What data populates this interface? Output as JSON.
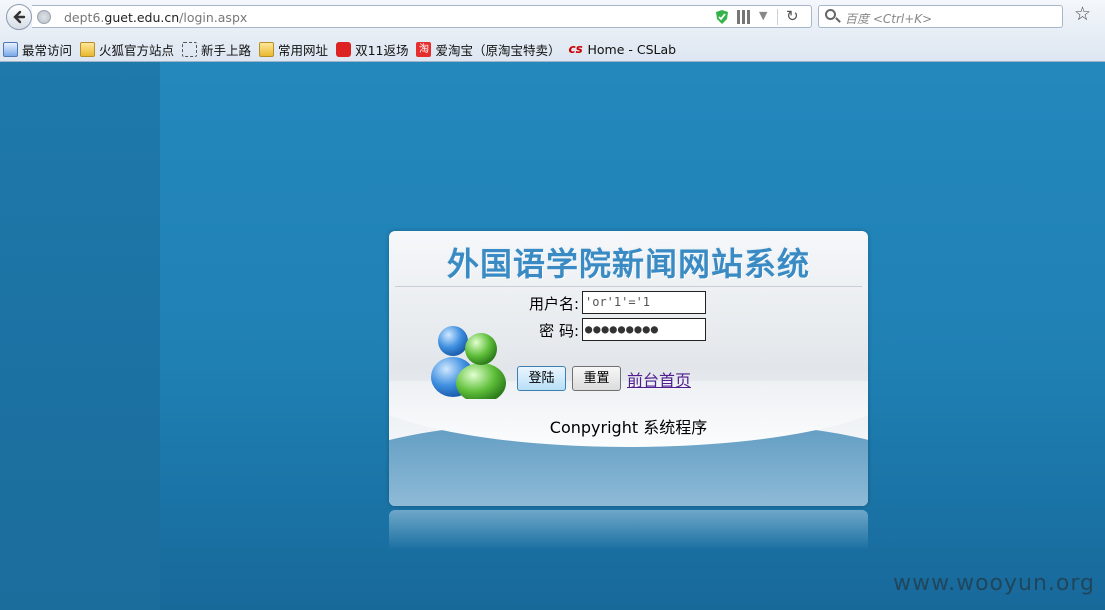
{
  "browser": {
    "url_prefix": "dept6.",
    "url_domain": "guet.edu.cn",
    "url_path": "/login.aspx",
    "search_placeholder": "百度 <Ctrl+K>"
  },
  "bookmarks": [
    {
      "label": "最常访问",
      "icon": "recent-icon"
    },
    {
      "label": "火狐官方站点",
      "icon": "folder-icon"
    },
    {
      "label": "新手上路",
      "icon": "dotted-page-icon"
    },
    {
      "label": "常用网址",
      "icon": "folder-icon"
    },
    {
      "label": "双11返场",
      "icon": "red-bag-icon"
    },
    {
      "label": "爱淘宝（原淘宝特卖）",
      "icon": "taobao-icon",
      "icon_glyph": "淘"
    },
    {
      "label": "Home - CSLab",
      "icon": "cslab-icon",
      "icon_glyph": "cs"
    }
  ],
  "login": {
    "title": "外国语学院新闻网站系统",
    "username_label": "用户名:",
    "password_label": "密 码:",
    "username_value": "'or'1'='1",
    "password_mask": "●●●●●●●●●",
    "login_button": "登陆",
    "reset_button": "重置",
    "front_link": "前台首页",
    "copyright": "Conpyright 系统程序"
  },
  "watermark": "www.wooyun.org",
  "colors": {
    "background_blue": "#2488bd",
    "title_blue": "#3a8bc4",
    "link_purple": "#4f1d8f"
  }
}
